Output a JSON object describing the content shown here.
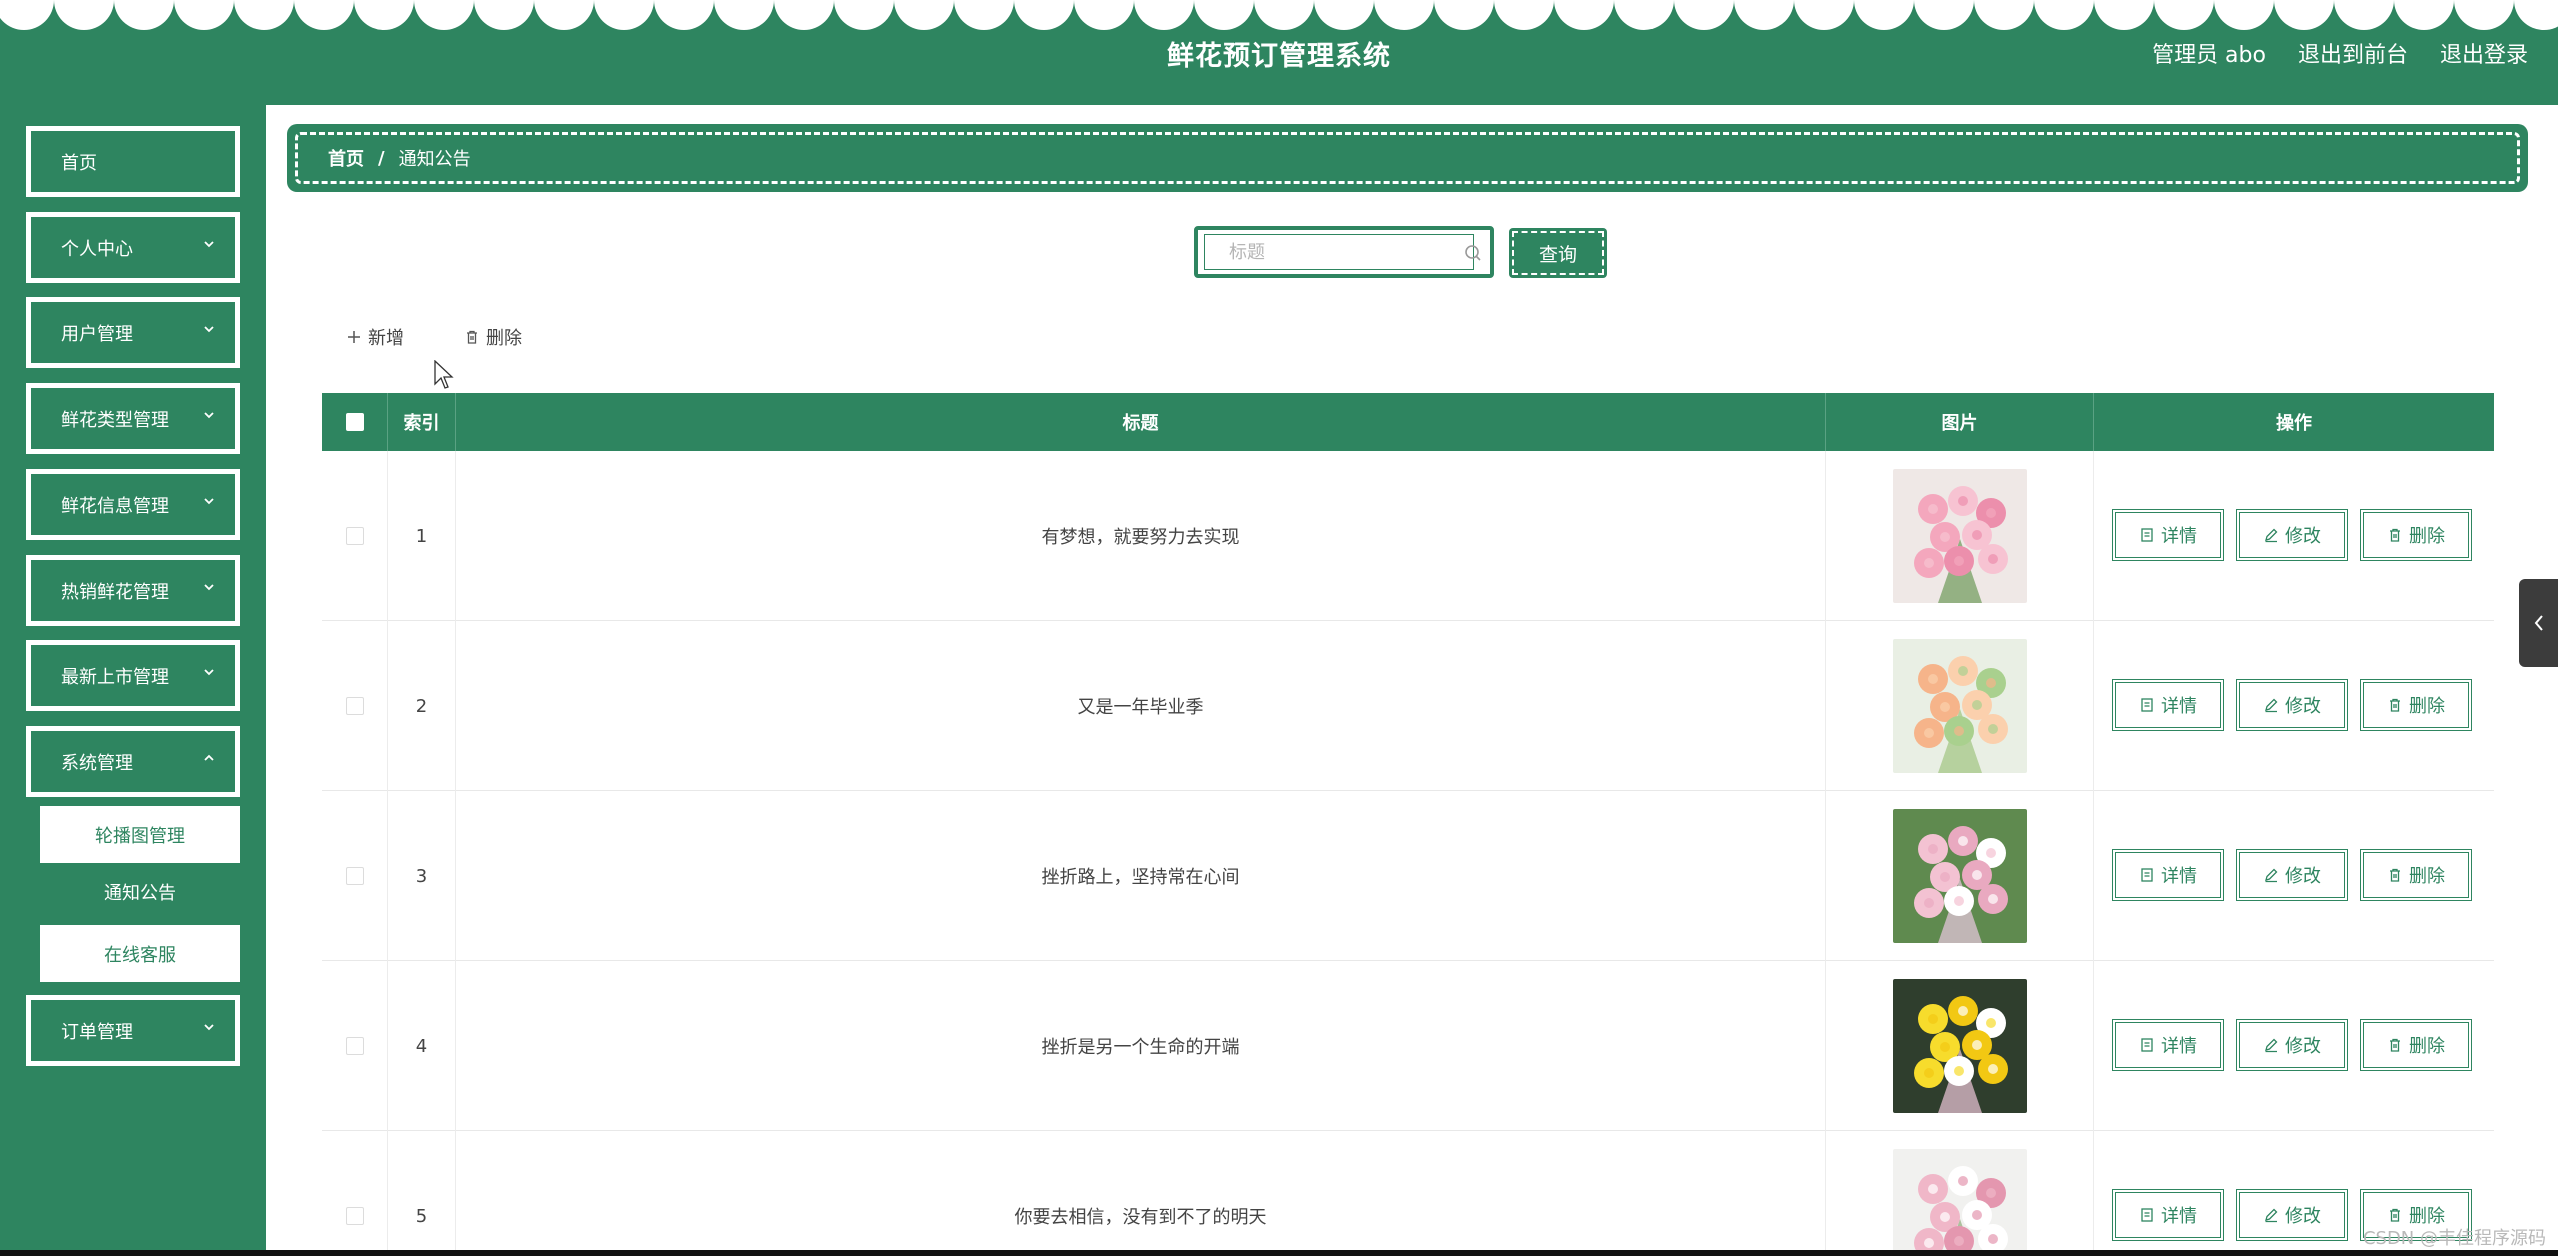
{
  "header": {
    "title": "鲜花预订管理系统",
    "admin_label": "管理员 abo",
    "front_link": "退出到前台",
    "logout_link": "退出登录"
  },
  "sidebar": {
    "items": [
      {
        "label": "首页",
        "has_children": false
      },
      {
        "label": "个人中心",
        "has_children": true
      },
      {
        "label": "用户管理",
        "has_children": true
      },
      {
        "label": "鲜花类型管理",
        "has_children": true
      },
      {
        "label": "鲜花信息管理",
        "has_children": true
      },
      {
        "label": "热销鲜花管理",
        "has_children": true
      },
      {
        "label": "最新上市管理",
        "has_children": true
      },
      {
        "label": "系统管理",
        "has_children": true,
        "expanded": true
      },
      {
        "label": "订单管理",
        "has_children": true
      }
    ],
    "submenu": [
      {
        "label": "轮播图管理",
        "active": false
      },
      {
        "label": "通知公告",
        "active": true
      },
      {
        "label": "在线客服",
        "active": false
      }
    ]
  },
  "breadcrumb": {
    "home": "首页",
    "separator": "/",
    "current": "通知公告"
  },
  "search": {
    "placeholder": "标题",
    "value": "",
    "button_label": "查询"
  },
  "toolbar": {
    "add_label": "新增",
    "delete_label": "删除"
  },
  "table": {
    "columns": [
      "索引",
      "标题",
      "图片",
      "操作"
    ],
    "rows": [
      {
        "index": "1",
        "title": "有梦想，就要努力去实现",
        "image": "pink-flowers-vase"
      },
      {
        "index": "2",
        "title": "又是一年毕业季",
        "image": "peach-rose-bouquet"
      },
      {
        "index": "3",
        "title": "挫折路上，坚持常在心间",
        "image": "pink-bouquet"
      },
      {
        "index": "4",
        "title": "挫折是另一个生命的开端",
        "image": "yellow-bouquet"
      },
      {
        "index": "5",
        "title": "你要去相信，没有到不了的明天",
        "image": "pink-white-bouquet"
      }
    ],
    "actions": {
      "detail": "详情",
      "edit": "修改",
      "delete": "删除"
    }
  },
  "watermark": "CSDN @丰佳程序源码"
}
